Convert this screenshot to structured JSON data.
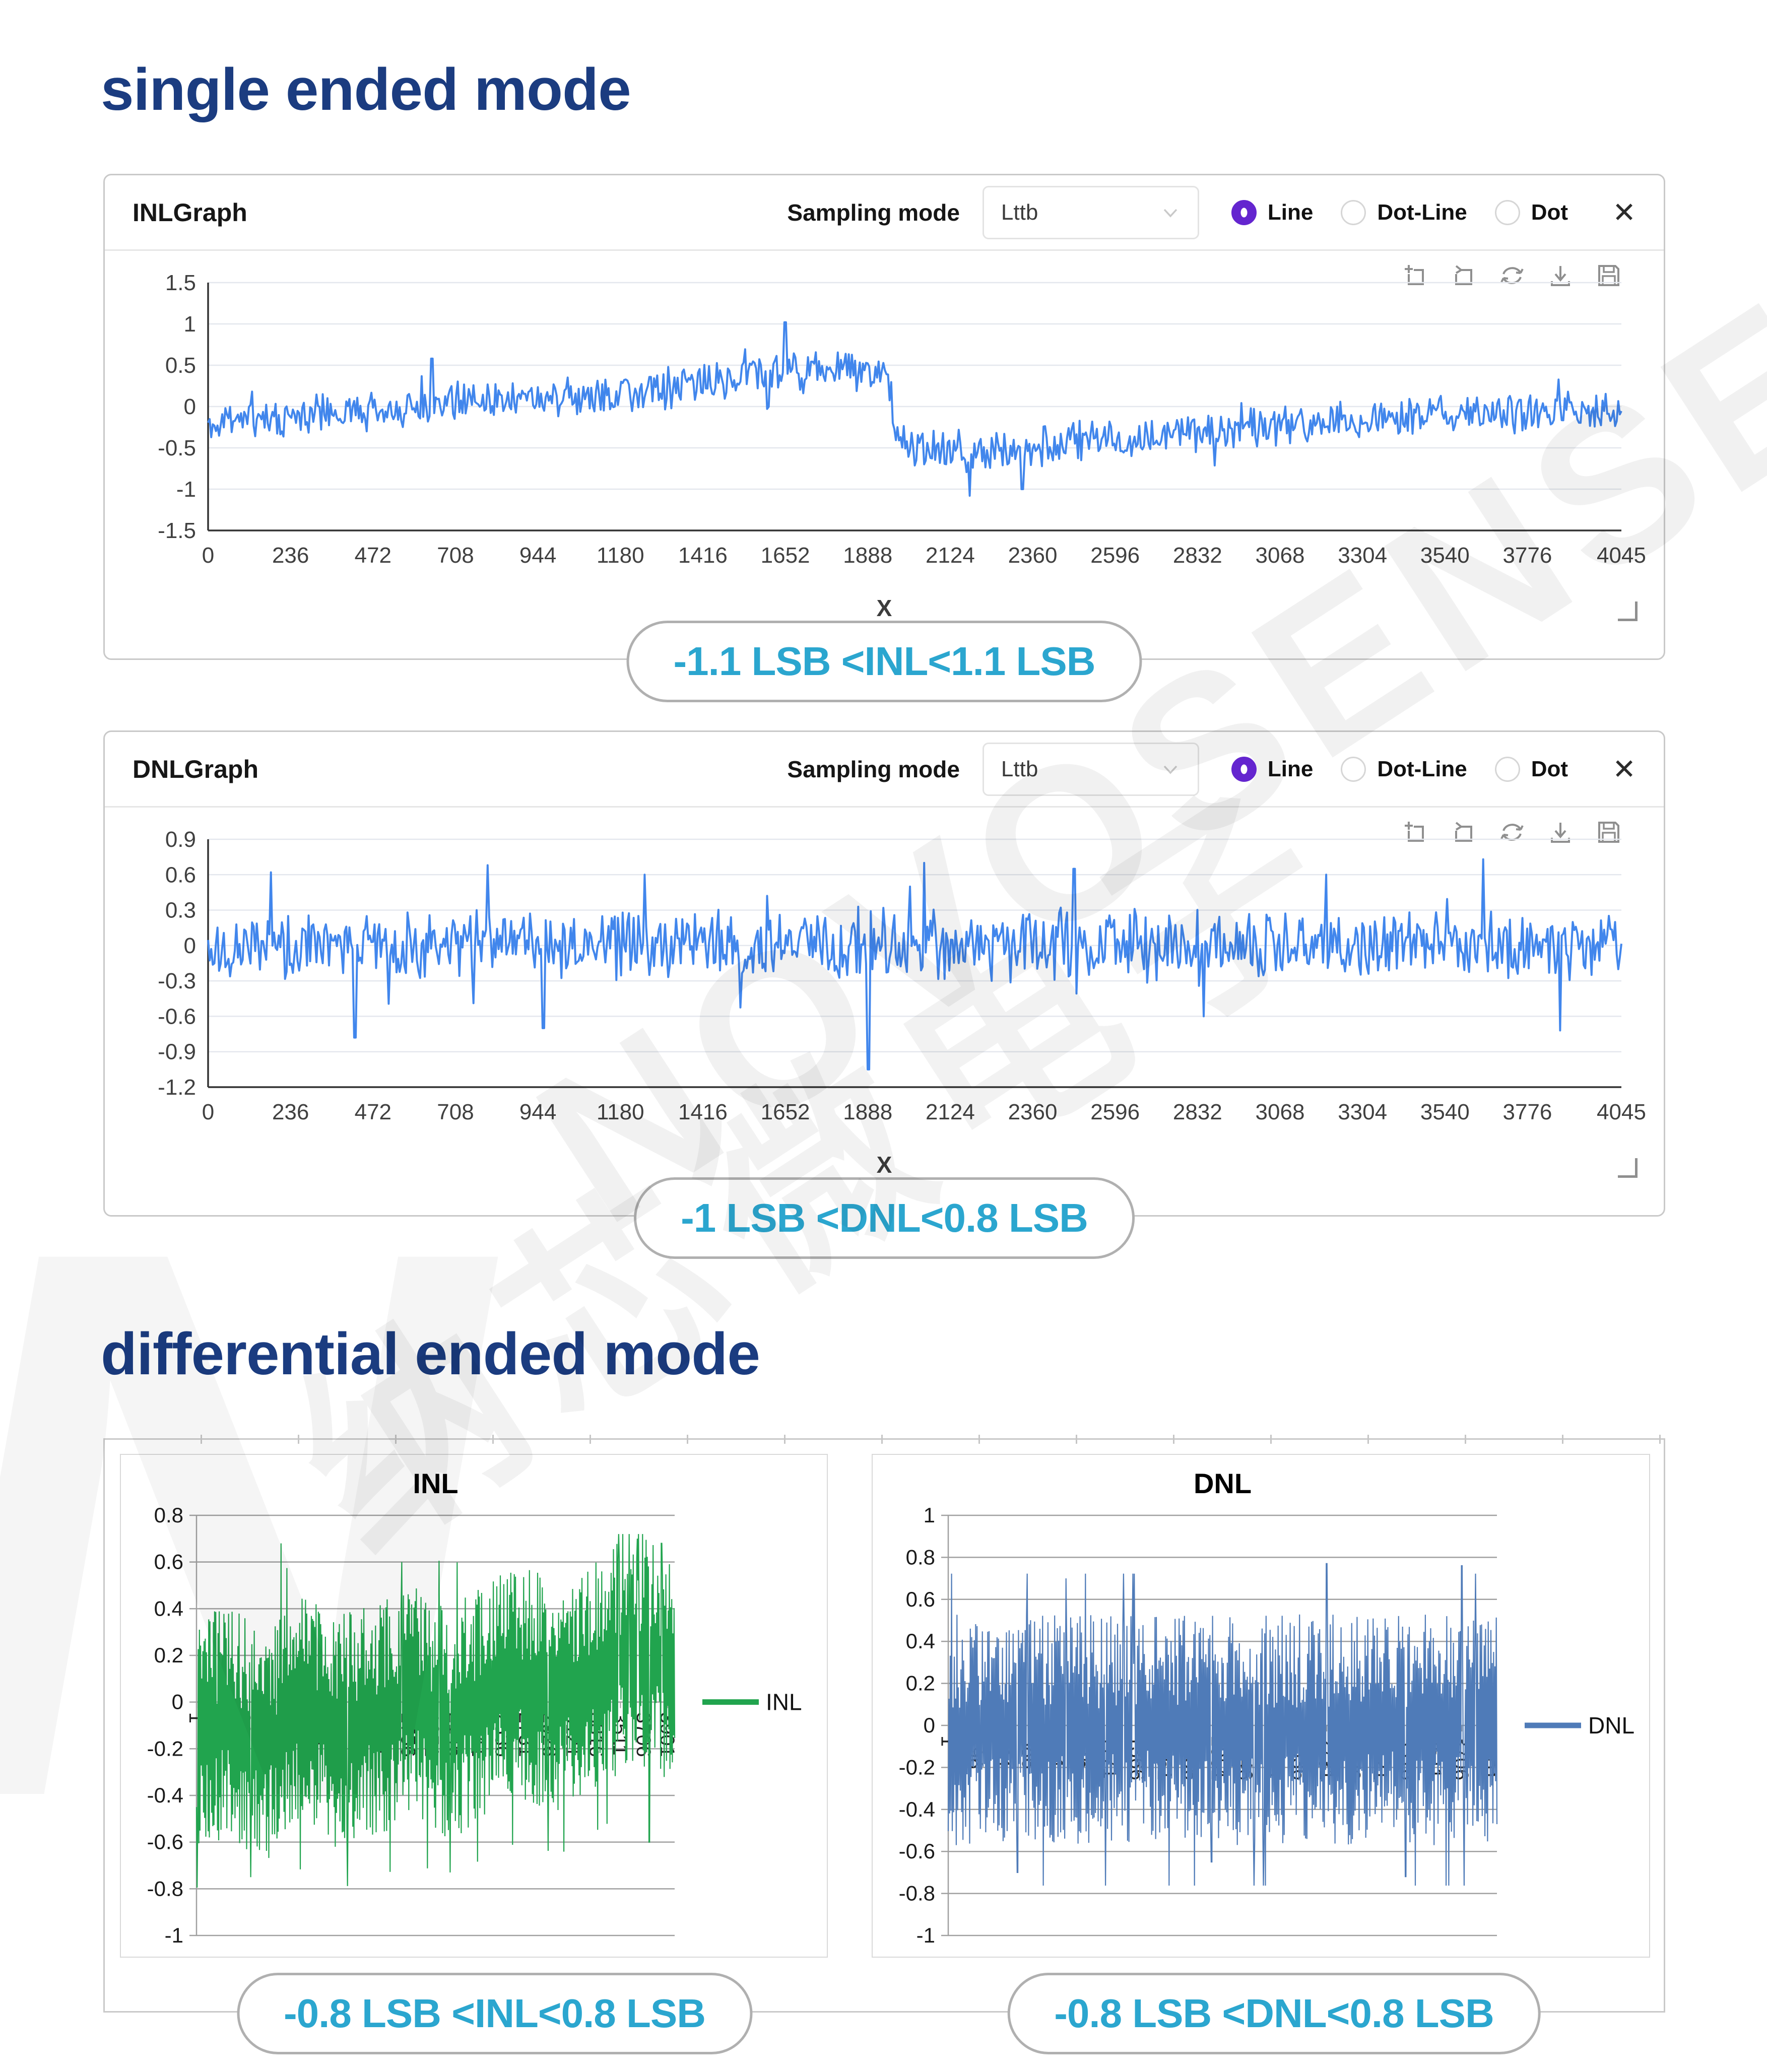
{
  "titles": {
    "single": "single ended mode",
    "differential": "differential ended mode"
  },
  "watermark": {
    "latin": "NOVOSENSE",
    "cjk": "纳芯微电子",
    "logo_letter": "N"
  },
  "toolbar": {
    "icons": [
      "zoom-box",
      "zoom-reset",
      "refresh",
      "download",
      "save"
    ]
  },
  "single_panels": [
    {
      "title": "INLGraph",
      "sampling_label": "Sampling mode",
      "sampling_value": "Lttb",
      "radios": [
        {
          "label": "Line",
          "selected": true
        },
        {
          "label": "Dot-Line",
          "selected": false
        },
        {
          "label": "Dot",
          "selected": false
        }
      ],
      "close_glyph": "✕",
      "x_axis_title": "X",
      "caption": "-1.1 LSB <INL<1.1 LSB",
      "chart_data": {
        "type": "line",
        "series_name": "INL",
        "color": "#4186ec",
        "xlabel": "X",
        "xlim": [
          0,
          4045
        ],
        "ylim": [
          -1.5,
          1.5
        ],
        "grid": true,
        "x_ticks": [
          "0",
          "236",
          "472",
          "708",
          "944",
          "1180",
          "1416",
          "1652",
          "1888",
          "2124",
          "2360",
          "2596",
          "2832",
          "3068",
          "3304",
          "3540",
          "3776",
          "4045"
        ],
        "y_ticks": [
          "1.5",
          "1",
          "0.5",
          "0",
          "-0.5",
          "-1",
          "-1.5"
        ],
        "envelope": [
          [
            0,
            -0.2
          ],
          [
            250,
            -0.12
          ],
          [
            500,
            -0.02
          ],
          [
            750,
            0.08
          ],
          [
            1000,
            0.12
          ],
          [
            1250,
            0.18
          ],
          [
            1500,
            0.35
          ],
          [
            1700,
            0.45
          ],
          [
            1900,
            0.42
          ],
          [
            1945,
            0.4
          ],
          [
            1975,
            -0.45
          ],
          [
            2100,
            -0.55
          ],
          [
            2350,
            -0.5
          ],
          [
            2600,
            -0.38
          ],
          [
            2850,
            -0.3
          ],
          [
            3100,
            -0.22
          ],
          [
            3400,
            -0.15
          ],
          [
            3700,
            -0.08
          ],
          [
            4045,
            -0.05
          ]
        ],
        "amplitude": 0.28,
        "spikes": [
          [
            640,
            0.58
          ],
          [
            1652,
            1.02
          ],
          [
            2180,
            -1.08
          ],
          [
            2330,
            -1.0
          ]
        ],
        "clip": [
          -1.15,
          1.1
        ],
        "n_points": 900,
        "seed": 11,
        "summary": "INL noise band; rises to ~+0.5 LSB near code 1900 then drops to ~-0.5 LSB; extremes -1.1 to +1.1 LSB"
      }
    },
    {
      "title": "DNLGraph",
      "sampling_label": "Sampling mode",
      "sampling_value": "Lttb",
      "radios": [
        {
          "label": "Line",
          "selected": true
        },
        {
          "label": "Dot-Line",
          "selected": false
        },
        {
          "label": "Dot",
          "selected": false
        }
      ],
      "close_glyph": "✕",
      "x_axis_title": "X",
      "caption": "-1 LSB <DNL<0.8 LSB",
      "chart_data": {
        "type": "line",
        "series_name": "DNL",
        "color": "#4186ec",
        "xlabel": "X",
        "xlim": [
          0,
          4045
        ],
        "ylim": [
          -1.2,
          0.9
        ],
        "grid": true,
        "x_ticks": [
          "0",
          "236",
          "472",
          "708",
          "944",
          "1180",
          "1416",
          "1652",
          "1888",
          "2124",
          "2360",
          "2596",
          "2832",
          "3068",
          "3304",
          "3540",
          "3776",
          "4045"
        ],
        "y_ticks": [
          "0.9",
          "0.6",
          "0.3",
          "0",
          "-0.3",
          "-0.6",
          "-0.9",
          "-1.2"
        ],
        "envelope": [
          [
            0,
            0
          ],
          [
            4045,
            0
          ]
        ],
        "amplitude": 0.33,
        "spikes": [
          [
            180,
            0.62
          ],
          [
            420,
            -0.78
          ],
          [
            800,
            0.68
          ],
          [
            960,
            -0.7
          ],
          [
            1250,
            0.6
          ],
          [
            1890,
            -1.05
          ],
          [
            2050,
            0.7
          ],
          [
            2480,
            0.65
          ],
          [
            2850,
            -0.6
          ],
          [
            3200,
            0.6
          ],
          [
            3650,
            0.73
          ],
          [
            3870,
            -0.72
          ]
        ],
        "clip": [
          -1.1,
          0.85
        ],
        "n_points": 900,
        "seed": 22,
        "summary": "DNL noise centered on 0; mostly within ±0.5 LSB; extremes -1 to +0.8 LSB"
      }
    }
  ],
  "diff_charts": [
    {
      "caption": "-0.8 LSB <INL<0.8 LSB",
      "chart_data": {
        "type": "line",
        "title": "INL",
        "legend": "INL",
        "legend_position": "right",
        "color": "#21a44e",
        "ylim": [
          -1,
          0.8
        ],
        "grid": true,
        "y_ticks": [
          "0.8",
          "0.6",
          "0.4",
          "0.2",
          "0",
          "-0.2",
          "-0.4",
          "-0.6",
          "-0.8",
          "-1"
        ],
        "categories": [
          "1",
          "196",
          "391",
          "586",
          "781",
          "976",
          "1171",
          "1366",
          "1561",
          "1756",
          "1951",
          "2146",
          "2341",
          "2536",
          "2731",
          "2926",
          "3121",
          "3316",
          "3511",
          "3706",
          "3901"
        ],
        "xmax": 3960,
        "envelope": [
          [
            1,
            -0.12
          ],
          [
            300,
            -0.1
          ],
          [
            600,
            -0.18
          ],
          [
            900,
            -0.02
          ],
          [
            1200,
            -0.12
          ],
          [
            1500,
            -0.08
          ],
          [
            1800,
            0.0
          ],
          [
            2100,
            -0.1
          ],
          [
            2400,
            0.02
          ],
          [
            2700,
            0.08
          ],
          [
            3000,
            0.02
          ],
          [
            3300,
            0.12
          ],
          [
            3600,
            0.22
          ],
          [
            3800,
            0.18
          ],
          [
            3960,
            0.1
          ]
        ],
        "amplitude": 0.5,
        "spikes": [
          [
            450,
            -0.75
          ],
          [
            700,
            0.68
          ],
          [
            1150,
            -0.62
          ],
          [
            1700,
            0.6
          ],
          [
            2100,
            -0.73
          ],
          [
            3650,
            0.7
          ],
          [
            3750,
            -0.6
          ],
          [
            3850,
            0.68
          ]
        ],
        "clip": [
          -0.82,
          0.72
        ],
        "n_points": 820,
        "seed": 33,
        "summary": "Differential-mode INL noise band within ±0.8 LSB, slight upward trend near end"
      }
    },
    {
      "caption": "-0.8 LSB <DNL<0.8 LSB",
      "chart_data": {
        "type": "line",
        "title": "DNL",
        "legend": "DNL",
        "legend_position": "right",
        "color": "#4f7bb8",
        "ylim": [
          -1,
          1
        ],
        "grid": true,
        "y_ticks": [
          "1",
          "0.8",
          "0.6",
          "0.4",
          "0.2",
          "0",
          "-0.2",
          "-0.4",
          "-0.6",
          "-0.8",
          "-1"
        ],
        "categories": [
          "1",
          "196",
          "391",
          "586",
          "781",
          "976",
          "1171",
          "1366",
          "1561",
          "1756",
          "1951",
          "2146",
          "2341",
          "2536",
          "2731",
          "2926",
          "3121",
          "3316",
          "3511",
          "3706",
          "3901"
        ],
        "xmax": 3960,
        "envelope": [
          [
            1,
            -0.02
          ],
          [
            3960,
            -0.02
          ]
        ],
        "amplitude": 0.55,
        "spikes": [
          [
            500,
            -0.7
          ],
          [
            850,
            0.7
          ],
          [
            1900,
            -0.65
          ],
          [
            2731,
            0.77
          ],
          [
            3300,
            -0.72
          ],
          [
            3706,
            0.76
          ]
        ],
        "clip": [
          -0.78,
          0.78
        ],
        "n_points": 820,
        "seed": 44,
        "summary": "Differential-mode DNL noise band within ±0.8 LSB, uniform across codes"
      }
    }
  ]
}
